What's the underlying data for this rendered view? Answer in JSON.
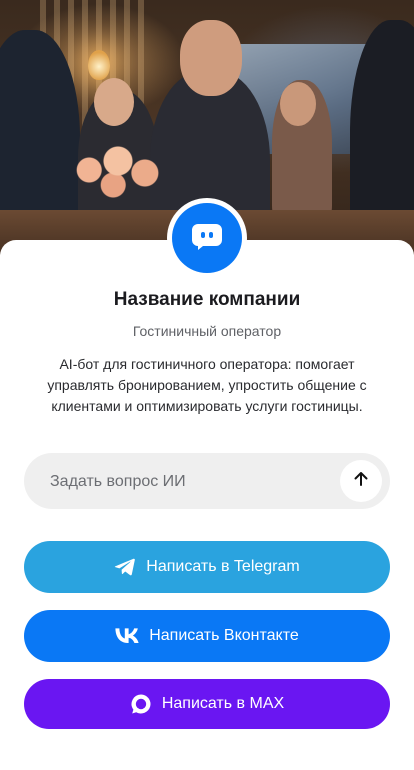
{
  "hero": {
    "image": "hotel-reception-photo"
  },
  "profile": {
    "avatar_icon": "chat-bot-icon",
    "company_name": "Название компании",
    "company_type": "Гостиничный оператор",
    "description": "AI-бот для гостиничного оператора: помогает управлять бронированием, упростить общение с клиентами и оптимизировать услуги гостиницы."
  },
  "ask": {
    "placeholder": "Задать вопрос ИИ",
    "value": "",
    "send_icon": "arrow-up-icon"
  },
  "buttons": {
    "telegram": {
      "label": "Написать в Telegram",
      "icon": "telegram-icon",
      "color": "#2aa3df"
    },
    "vk": {
      "label": "Написать Вконтакте",
      "icon": "vk-icon",
      "color": "#0a78f5"
    },
    "max": {
      "label": "Написать в MAX",
      "icon": "max-icon",
      "color": "#6a16f2"
    }
  }
}
